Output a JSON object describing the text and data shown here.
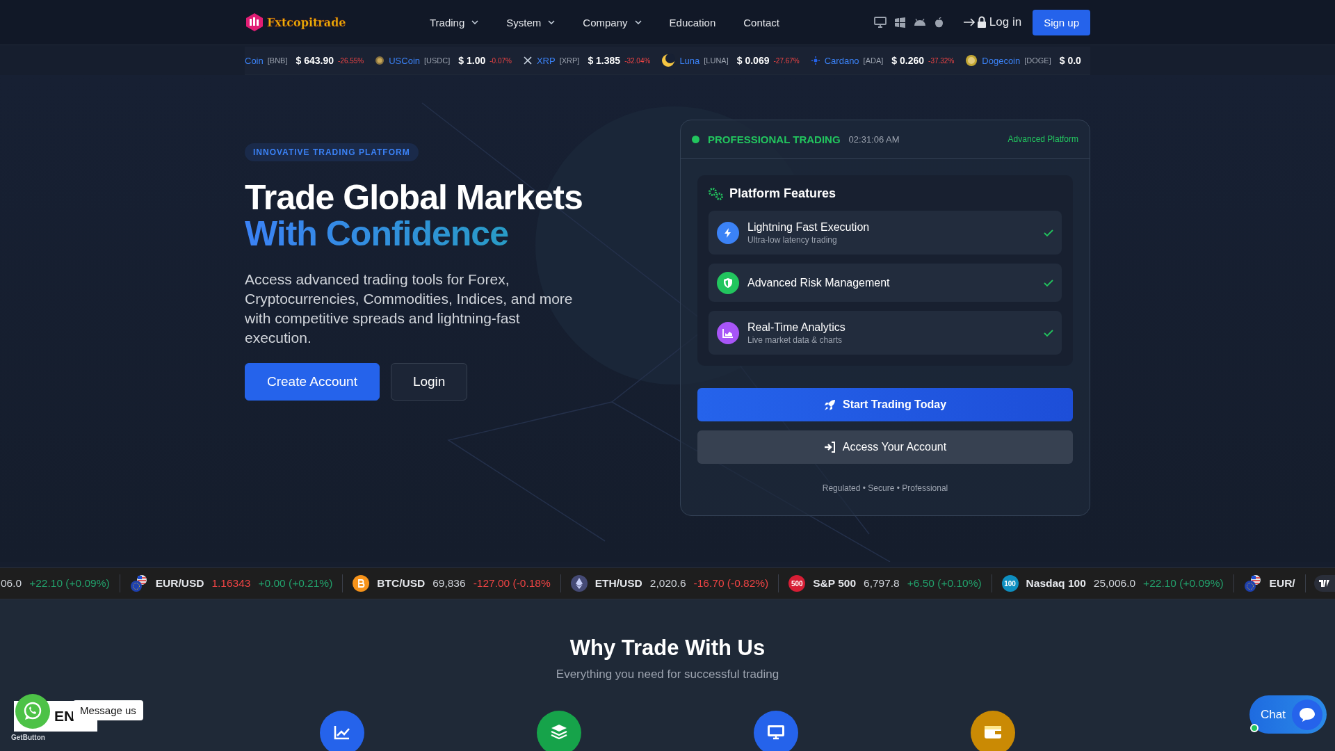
{
  "header": {
    "logo": "Fxtcopitrade",
    "nav": [
      {
        "label": "Trading",
        "dropdown": true
      },
      {
        "label": "System",
        "dropdown": true
      },
      {
        "label": "Company",
        "dropdown": true
      },
      {
        "label": "Education",
        "dropdown": false
      },
      {
        "label": "Contact",
        "dropdown": false
      }
    ],
    "login": "Log in",
    "signup": "Sign up"
  },
  "crypto_ticker": [
    {
      "kind": "none",
      "name": "Coin",
      "symbol": "[BNB]",
      "price": "$ 643.90",
      "change": "-26.55%"
    },
    {
      "kind": "usdc",
      "name": "USCoin",
      "symbol": "[USDC]",
      "price": "$ 1.00",
      "change": "-0.07%"
    },
    {
      "kind": "xrp",
      "name": "XRP",
      "symbol": "[XRP]",
      "price": "$ 1.385",
      "change": "-32.04%"
    },
    {
      "kind": "luna",
      "name": "Luna",
      "symbol": "[LUNA]",
      "price": "$ 0.069",
      "change": "-27.67%"
    },
    {
      "kind": "ada",
      "name": "Cardano",
      "symbol": "[ADA]",
      "price": "$ 0.260",
      "change": "-37.32%"
    },
    {
      "kind": "doge",
      "name": "Dogecoin",
      "symbol": "[DOGE]",
      "price": "$ 0.0"
    }
  ],
  "hero": {
    "badge": "INNOVATIVE TRADING PLATFORM",
    "title": "Trade Global Markets",
    "title_accent": "With Confidence",
    "text": "Access advanced trading tools for Forex, Cryptocurrencies, Commodities, Indices, and more with competitive spreads and lightning-fast execution.",
    "buttons": [
      {
        "label": "Create Account",
        "kind": "primary"
      },
      {
        "label": "Login",
        "kind": "secondary"
      }
    ]
  },
  "card": {
    "status": "PROFESSIONAL TRADING",
    "time": "02:31:06 AM",
    "tag": "Advanced Platform",
    "panel_title": "Platform Features",
    "features": [
      {
        "kind": "bolt",
        "title": "Lightning Fast Execution",
        "subtitle": "Ultra-low latency trading",
        "checked": true
      },
      {
        "kind": "shield",
        "title": "Advanced Risk Management",
        "checked": true
      },
      {
        "kind": "analytics",
        "title": "Real-Time Analytics",
        "subtitle": "Live market data & charts",
        "checked": true
      }
    ],
    "buttons": [
      {
        "label": "Start Trading Today",
        "kind": "primary"
      },
      {
        "label": "Access Your Account",
        "kind": "secondary"
      }
    ],
    "footer": "Regulated • Secure • Professional"
  },
  "market_ticker": [
    {
      "kind": "none",
      "price": "06.0",
      "change": "+22.10 (+0.09%)",
      "change_down": false,
      "price_down": false
    },
    {
      "kind": "fx",
      "name": "EUR/USD",
      "price": "1.16343",
      "change": "+0.00 (+0.21%)",
      "change_down": false,
      "price_down": true
    },
    {
      "kind": "btc",
      "name": "BTC/USD",
      "price": "69,836",
      "change": "-127.00 (-0.18%",
      "change_down": true,
      "price_down": false
    },
    {
      "kind": "eth",
      "name": "ETH/USD",
      "price": "2,020.6",
      "change": "-16.70 (-0.82%)",
      "change_down": true,
      "price_down": false
    },
    {
      "kind": "badge",
      "badge": "500",
      "color": "#d71e35",
      "name": "S&P 500",
      "price": "6,797.8",
      "change": "+6.50 (+0.10%)",
      "change_down": false,
      "price_down": false
    },
    {
      "kind": "badge",
      "badge": "100",
      "color": "#0e8fc0",
      "name": "Nasdaq 100",
      "price": "25,006.0",
      "change": "+22.10 (+0.09%)",
      "change_down": false,
      "price_down": false
    },
    {
      "kind": "fx",
      "name": "EUR/"
    }
  ],
  "why": {
    "title": "Why Trade With Us",
    "subtitle": "Everything you need for successful trading",
    "icons": [
      {
        "kind": "chart",
        "color": "#2563eb"
      },
      {
        "kind": "layers",
        "color": "#16a34a"
      },
      {
        "kind": "monitor",
        "color": "#2563eb"
      },
      {
        "kind": "wallet",
        "color": "#ca8a04"
      }
    ]
  },
  "widgets": {
    "language": "EN",
    "message": "Message us",
    "brand": "GetButton",
    "chat": "Chat"
  }
}
